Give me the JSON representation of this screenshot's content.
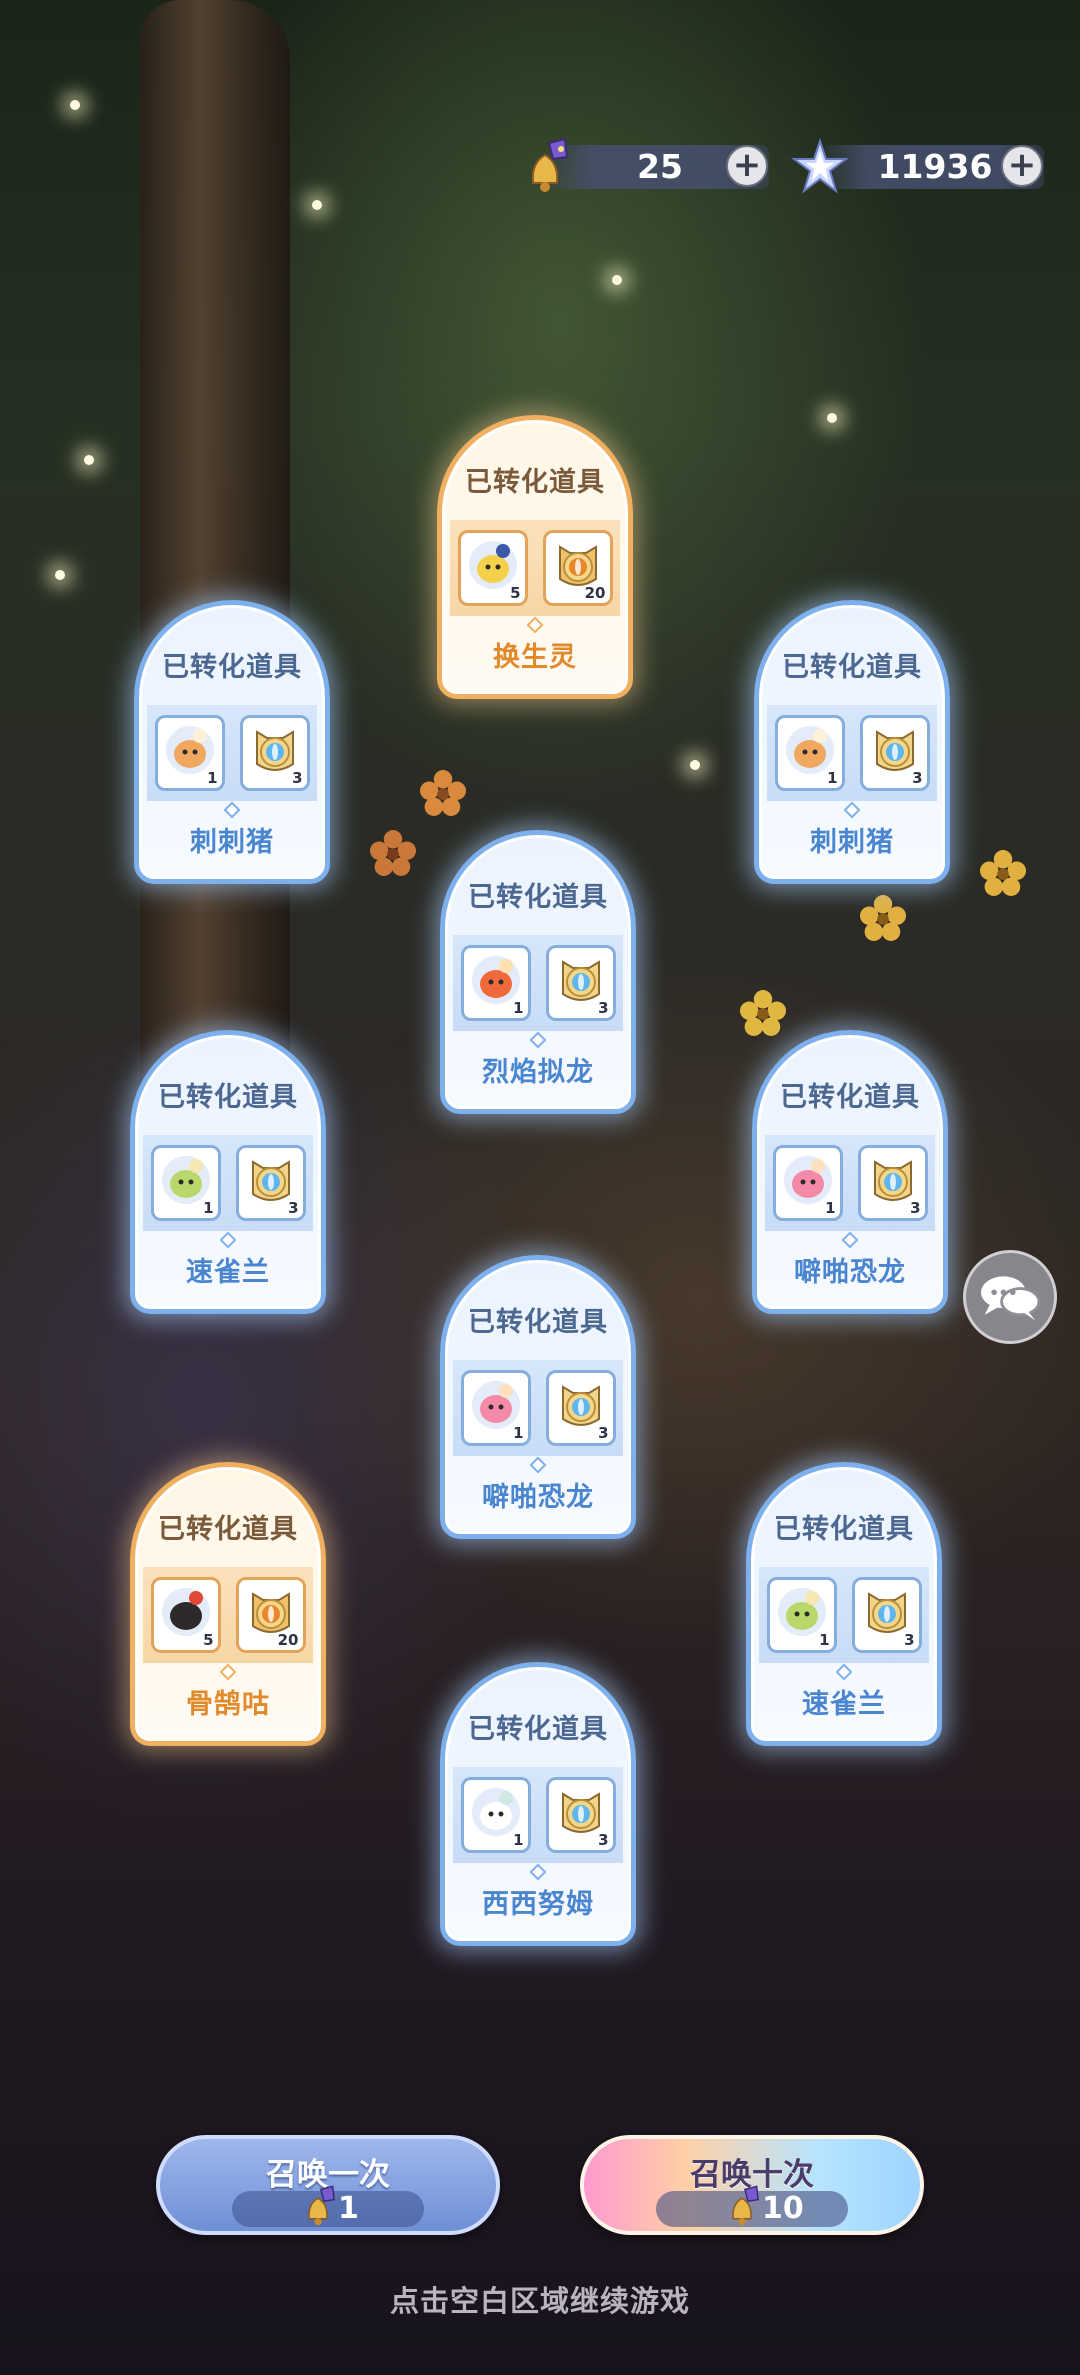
{
  "currency": {
    "bell": {
      "icon": "bell-icon",
      "value": "25"
    },
    "star": {
      "icon": "star-crystal-icon",
      "value": "11936"
    }
  },
  "cards": [
    {
      "title": "已转化道具",
      "name": "换生灵",
      "theme": "orange",
      "items": [
        {
          "icon": "pet-monster-icon",
          "count": "5"
        },
        {
          "icon": "orange-fox-coin-icon",
          "count": "20"
        }
      ]
    },
    {
      "title": "已转化道具",
      "name": "刺刺猪",
      "theme": "blue",
      "items": [
        {
          "icon": "pet-hedgehog-icon",
          "count": "1"
        },
        {
          "icon": "blue-fox-coin-icon",
          "count": "3"
        }
      ]
    },
    {
      "title": "已转化道具",
      "name": "刺刺猪",
      "theme": "blue",
      "items": [
        {
          "icon": "pet-hedgehog-icon",
          "count": "1"
        },
        {
          "icon": "blue-fox-coin-icon",
          "count": "3"
        }
      ]
    },
    {
      "title": "已转化道具",
      "name": "烈焰拟龙",
      "theme": "blue",
      "items": [
        {
          "icon": "pet-fire-dragon-icon",
          "count": "1"
        },
        {
          "icon": "blue-fox-coin-icon",
          "count": "3"
        }
      ]
    },
    {
      "title": "已转化道具",
      "name": "速雀兰",
      "theme": "blue",
      "items": [
        {
          "icon": "pet-bird-icon",
          "count": "1"
        },
        {
          "icon": "blue-fox-coin-icon",
          "count": "3"
        }
      ]
    },
    {
      "title": "已转化道具",
      "name": "噼啪恐龙",
      "theme": "blue",
      "items": [
        {
          "icon": "pet-pink-dino-icon",
          "count": "1"
        },
        {
          "icon": "blue-fox-coin-icon",
          "count": "3"
        }
      ]
    },
    {
      "title": "已转化道具",
      "name": "噼啪恐龙",
      "theme": "blue",
      "items": [
        {
          "icon": "pet-pink-dino-icon",
          "count": "1"
        },
        {
          "icon": "blue-fox-coin-icon",
          "count": "3"
        }
      ]
    },
    {
      "title": "已转化道具",
      "name": "骨鹄咕",
      "theme": "orange",
      "items": [
        {
          "icon": "pet-dark-bird-icon",
          "count": "5"
        },
        {
          "icon": "orange-fox-coin-icon",
          "count": "20"
        }
      ]
    },
    {
      "title": "已转化道具",
      "name": "速雀兰",
      "theme": "blue",
      "items": [
        {
          "icon": "pet-bird-icon",
          "count": "1"
        },
        {
          "icon": "blue-fox-coin-icon",
          "count": "3"
        }
      ]
    },
    {
      "title": "已转化道具",
      "name": "西西努姆",
      "theme": "blue",
      "items": [
        {
          "icon": "pet-white-ghost-icon",
          "count": "1"
        },
        {
          "icon": "blue-fox-coin-icon",
          "count": "3"
        }
      ]
    }
  ],
  "chat": {
    "icon": "chat-bubbles-icon"
  },
  "buttons": {
    "summon_one": {
      "label": "召唤一次",
      "cost_icon": "bell-icon",
      "cost": "1"
    },
    "summon_ten": {
      "label": "召唤十次",
      "cost_icon": "bell-icon",
      "cost": "10"
    }
  },
  "hint": "点击空白区域继续游戏",
  "colors": {
    "card_blue_border": "#7eb0ee",
    "card_orange_border": "#f0b060",
    "name_blue": "#4a86d0",
    "name_orange": "#e08a2c"
  }
}
